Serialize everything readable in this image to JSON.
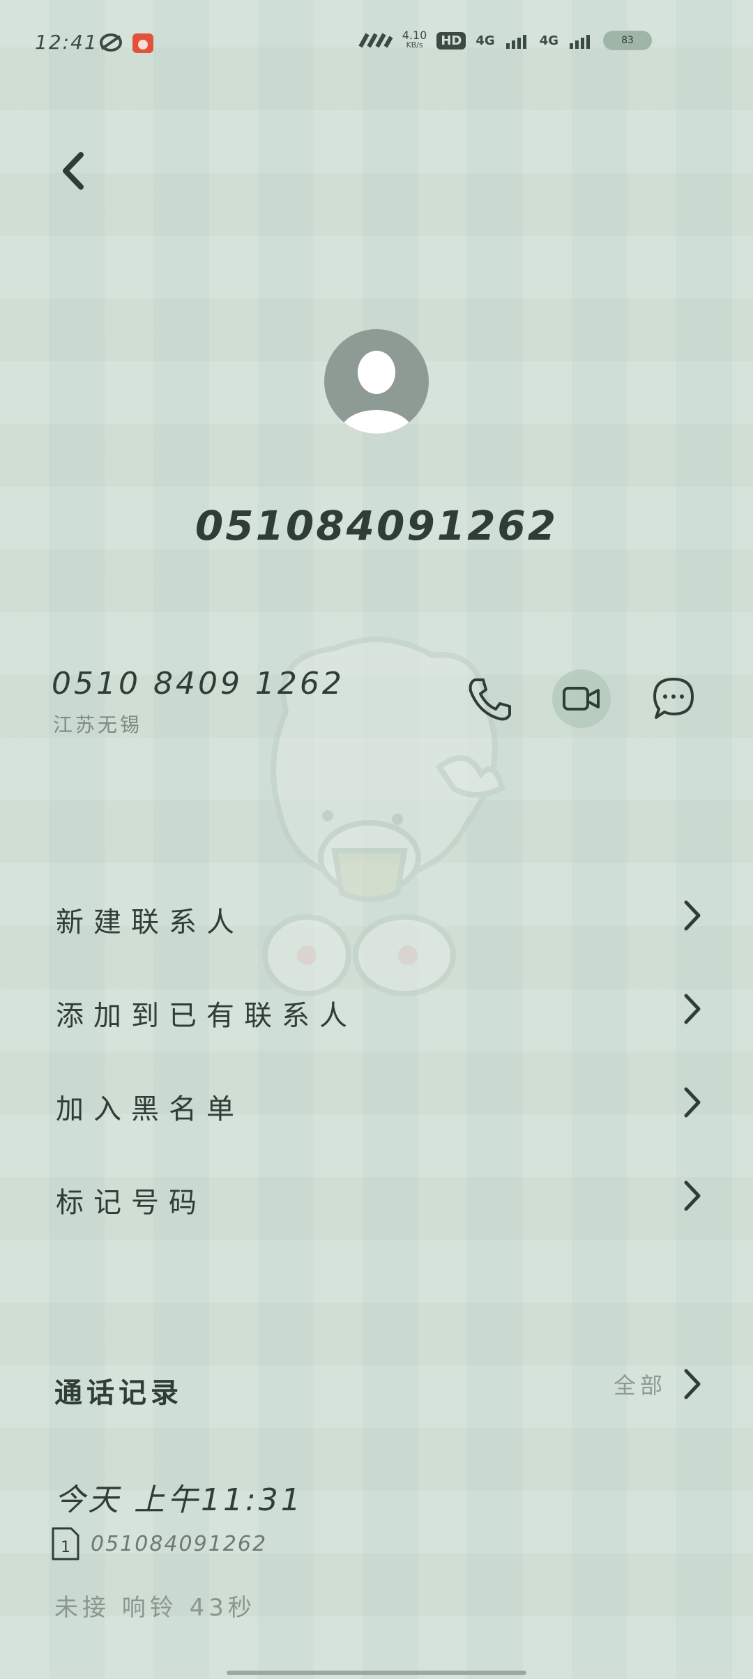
{
  "status_bar": {
    "time": "12:41",
    "net_speed": "4.10",
    "net_unit": "KB/s",
    "hd": "HD",
    "sig1": "4G",
    "sig2": "4G",
    "battery": "83"
  },
  "contact": {
    "number": "051084091262",
    "number_formatted": "0510 8409 1262",
    "location": "江苏无锡"
  },
  "menu": [
    {
      "label": "新建联系人"
    },
    {
      "label": "添加到已有联系人"
    },
    {
      "label": "加入黑名单"
    },
    {
      "label": "标记号码"
    }
  ],
  "call_log": {
    "title": "通话记录",
    "all_label": "全部",
    "entry": {
      "time": "今天 上午11:31",
      "sim": "1",
      "number": "051084091262",
      "status": "未接 响铃 43秒"
    }
  },
  "icons": {
    "back": "back-arrow-icon",
    "call": "phone-icon",
    "video": "video-call-icon",
    "message": "message-icon",
    "chevron": "chevron-right-icon",
    "sim": "sim-card-icon"
  }
}
